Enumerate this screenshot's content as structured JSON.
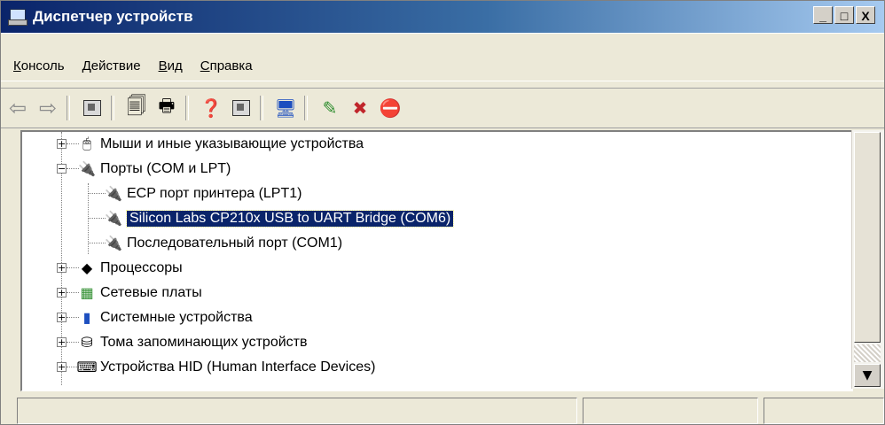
{
  "window": {
    "title": "Диспетчер устройств",
    "controls": [
      "_",
      "□",
      "X"
    ]
  },
  "menu": [
    {
      "accel": "К",
      "rest": "онсоль"
    },
    {
      "accel": "Д",
      "rest": "ействие"
    },
    {
      "accel": "В",
      "rest": "ид"
    },
    {
      "accel": "С",
      "rest": "правка"
    }
  ],
  "toolbar": {
    "icons": [
      "back-arrow-icon",
      "forward-arrow-icon",
      "show-hide-console-tree-icon",
      "properties-icon",
      "print-icon",
      "help-icon",
      "show-hide-action-pane-icon",
      "scan-hardware-icon",
      "update-driver-icon",
      "uninstall-icon",
      "disable-icon"
    ]
  },
  "tree": {
    "items": [
      {
        "label": "Мыши и иные указывающие устройства",
        "level": 0,
        "expander": "+",
        "icon": "mouse-icon"
      },
      {
        "label": "Порты (COM и LPT)",
        "level": 0,
        "expander": "−",
        "icon": "port-icon"
      },
      {
        "label": "ECP порт принтера (LPT1)",
        "level": 1,
        "icon": "port-icon"
      },
      {
        "label": "Silicon Labs CP210x USB to UART Bridge (COM6)",
        "level": 1,
        "icon": "port-icon",
        "selected": true
      },
      {
        "label": "Последовательный порт (COM1)",
        "level": 1,
        "icon": "port-icon"
      },
      {
        "label": "Процессоры",
        "level": 0,
        "expander": "+",
        "icon": "processor-icon"
      },
      {
        "label": "Сетевые платы",
        "level": 0,
        "expander": "+",
        "icon": "network-card-icon"
      },
      {
        "label": "Системные устройства",
        "level": 0,
        "expander": "+",
        "icon": "system-devices-icon"
      },
      {
        "label": "Тома запоминающих устройств",
        "level": 0,
        "expander": "+",
        "icon": "storage-volumes-icon"
      },
      {
        "label": "Устройства HID (Human Interface Devices)",
        "level": 0,
        "expander": "+",
        "icon": "hid-icon"
      }
    ]
  },
  "colors": {
    "selection": "#0a246a",
    "titlebar_start": "#0a246a",
    "titlebar_end": "#a6caf0",
    "chrome": "#ece9d8"
  }
}
